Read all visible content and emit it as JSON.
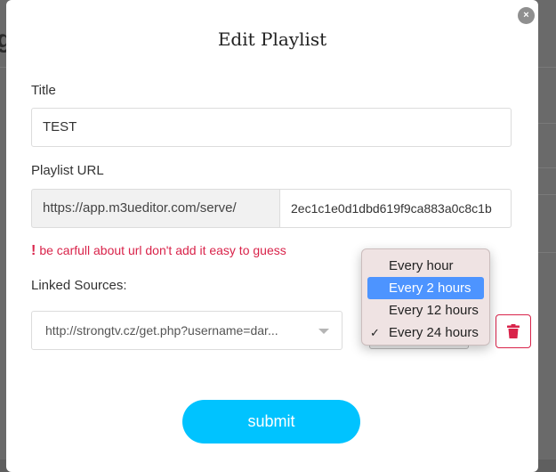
{
  "modal": {
    "title": "Edit Playlist",
    "close_glyph": "×"
  },
  "title_field": {
    "label": "Title",
    "value": "TEST"
  },
  "url_field": {
    "label": "Playlist URL",
    "prefix": "https://app.m3ueditor.com/serve/",
    "value": "2ec1c1e0d1dbd619f9ca883a0c8c1b"
  },
  "warning": {
    "icon": "!",
    "text": "be carfull about url don't add it easy to guess"
  },
  "linked_sources": {
    "label": "Linked Sources:",
    "source_value": "http://strongtv.cz/get.php?username=dar...",
    "frequency_options": [
      "Every hour",
      "Every 2 hours",
      "Every 12 hours",
      "Every 24 hours"
    ],
    "highlighted_option": "Every 2 hours",
    "checked_option": "Every 24 hours",
    "check_glyph": "✓"
  },
  "submit": {
    "label": "submit"
  },
  "colors": {
    "accent": "#00c3ff",
    "danger": "#d9234a",
    "highlight": "#4d94ff"
  },
  "icons": {
    "delete": "trash-icon",
    "close": "close-icon"
  }
}
